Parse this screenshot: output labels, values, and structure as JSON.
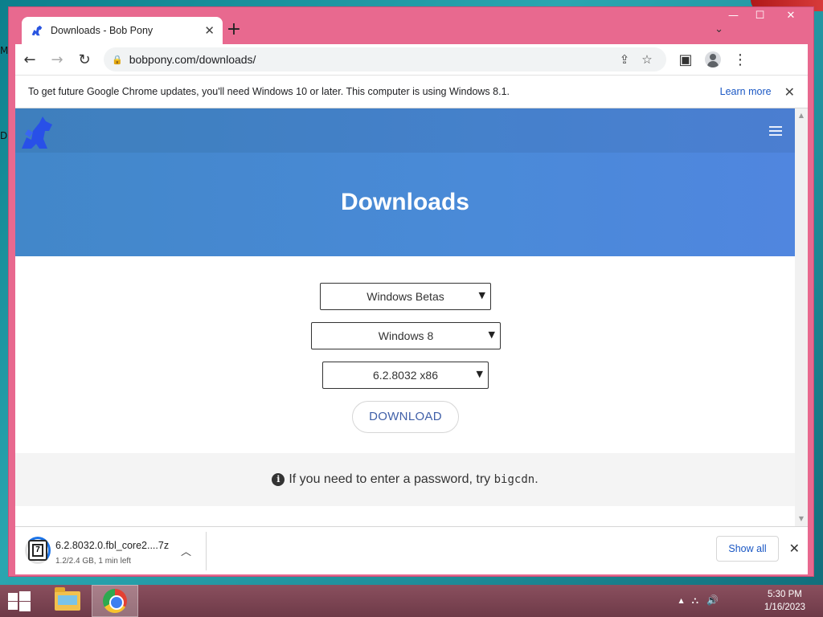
{
  "desktop": {
    "edge_text_1": "M",
    "edge_text_2": "D"
  },
  "window": {
    "minimize": "—",
    "maximize": "☐",
    "close": "✕"
  },
  "tab": {
    "title": "Downloads - Bob Pony",
    "close": "✕",
    "new_tab": "+",
    "tab_list": "⌄"
  },
  "toolbar": {
    "back": "←",
    "forward": "→",
    "reload": "↻",
    "url": "bobpony.com/downloads/",
    "share": "⇪",
    "bookmark": "☆",
    "sidepanel": "▣",
    "menu": "⋮"
  },
  "infobar": {
    "message": "To get future Google Chrome updates, you'll need Windows 10 or later. This computer is using Windows 8.1.",
    "link": "Learn more",
    "close": "✕"
  },
  "page": {
    "title": "Downloads",
    "select_category": "Windows Betas",
    "select_os": "Windows 8",
    "select_build": "6.2.8032 x86",
    "download_button": "DOWNLOAD",
    "note_prefix": "If you need to enter a password, try",
    "note_password": "bigcdn",
    "note_suffix": "."
  },
  "download_shelf": {
    "file_name": "6.2.8032.0.fbl_core2....7z",
    "status": "1.2/2.4 GB, 1 min left",
    "progress_fraction": 0.5,
    "show_all": "Show all",
    "close": "✕"
  },
  "taskbar": {
    "time": "5:30 PM",
    "date": "1/16/2023",
    "tray_up": "▲",
    "tray_network": "⛬",
    "tray_volume": "🔊"
  },
  "colors": {
    "window_frame": "#e8698f",
    "hero_blue": "#4a8ad8",
    "link_blue": "#1a57c4",
    "taskbar": "#7a4352"
  }
}
